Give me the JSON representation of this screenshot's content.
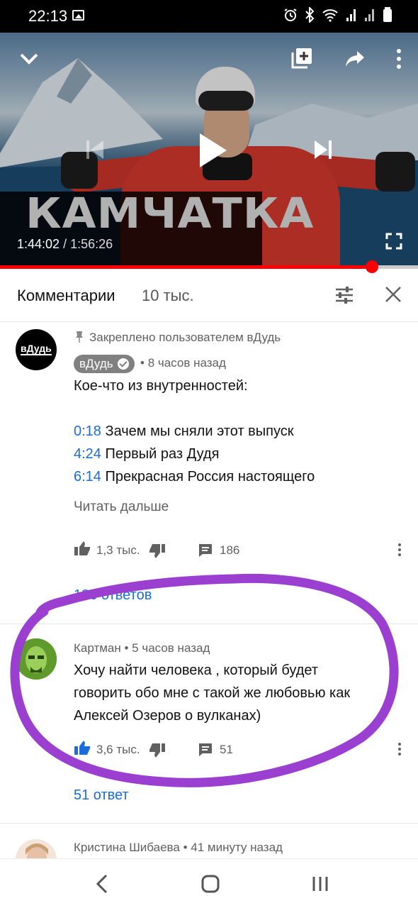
{
  "status_bar": {
    "time": "22:13",
    "icons": [
      "gallery-icon",
      "alarm-icon",
      "bluetooth-icon",
      "wifi-icon",
      "signal-icon",
      "signal-icon",
      "battery-icon"
    ]
  },
  "player": {
    "overlay_title": "КАМЧАТКА",
    "current_time": "1:44:02",
    "separator": " / ",
    "duration": "1:56:26",
    "progress_fraction": 0.89,
    "accent_color": "#ff0000",
    "controls": [
      "chevron-down-icon",
      "add-to-playlist-icon",
      "share-icon",
      "more-vert-icon",
      "previous-icon",
      "play-icon",
      "next-icon",
      "fullscreen-icon"
    ]
  },
  "comments_header": {
    "title": "Комментарии",
    "count": "10 тыс."
  },
  "comments": [
    {
      "pinned_label": "Закреплено пользователем вДудь",
      "avatar_text": "вДудь",
      "author": "вДудь",
      "verified": true,
      "meta_sep": " • ",
      "time": "8 часов назад",
      "text_intro": "Кое-что из внутренностей:",
      "chapters": [
        {
          "ts": "0:18",
          "title": "Зачем мы сняли этот выпуск"
        },
        {
          "ts": "4:24",
          "title": "Первый раз Дудя"
        },
        {
          "ts": "6:14",
          "title": "Прекрасная Россия настоящего"
        }
      ],
      "read_more": "Читать дальше",
      "likes": "1,3 тыс.",
      "reply_count": "186",
      "replies_link": "186 ответов"
    },
    {
      "author": "Картман",
      "meta_sep": " • ",
      "time": "5 часов назад",
      "text_lines": [
        "Хочу найти человека , который будет",
        "говорить обо мне с такой же любовью как",
        "Алексей Озеров о вулканах)"
      ],
      "likes": "3,6 тыс.",
      "liked": true,
      "reply_count": "51",
      "replies_link": "51 ответ"
    },
    {
      "author": "Кристина Шибаева",
      "meta_sep": " • ",
      "time": "41 минуту назад"
    }
  ],
  "annotation": {
    "color": "#9b3fd0"
  },
  "colors": {
    "link": "#1a6dd6",
    "secondary_text": "#606060"
  }
}
